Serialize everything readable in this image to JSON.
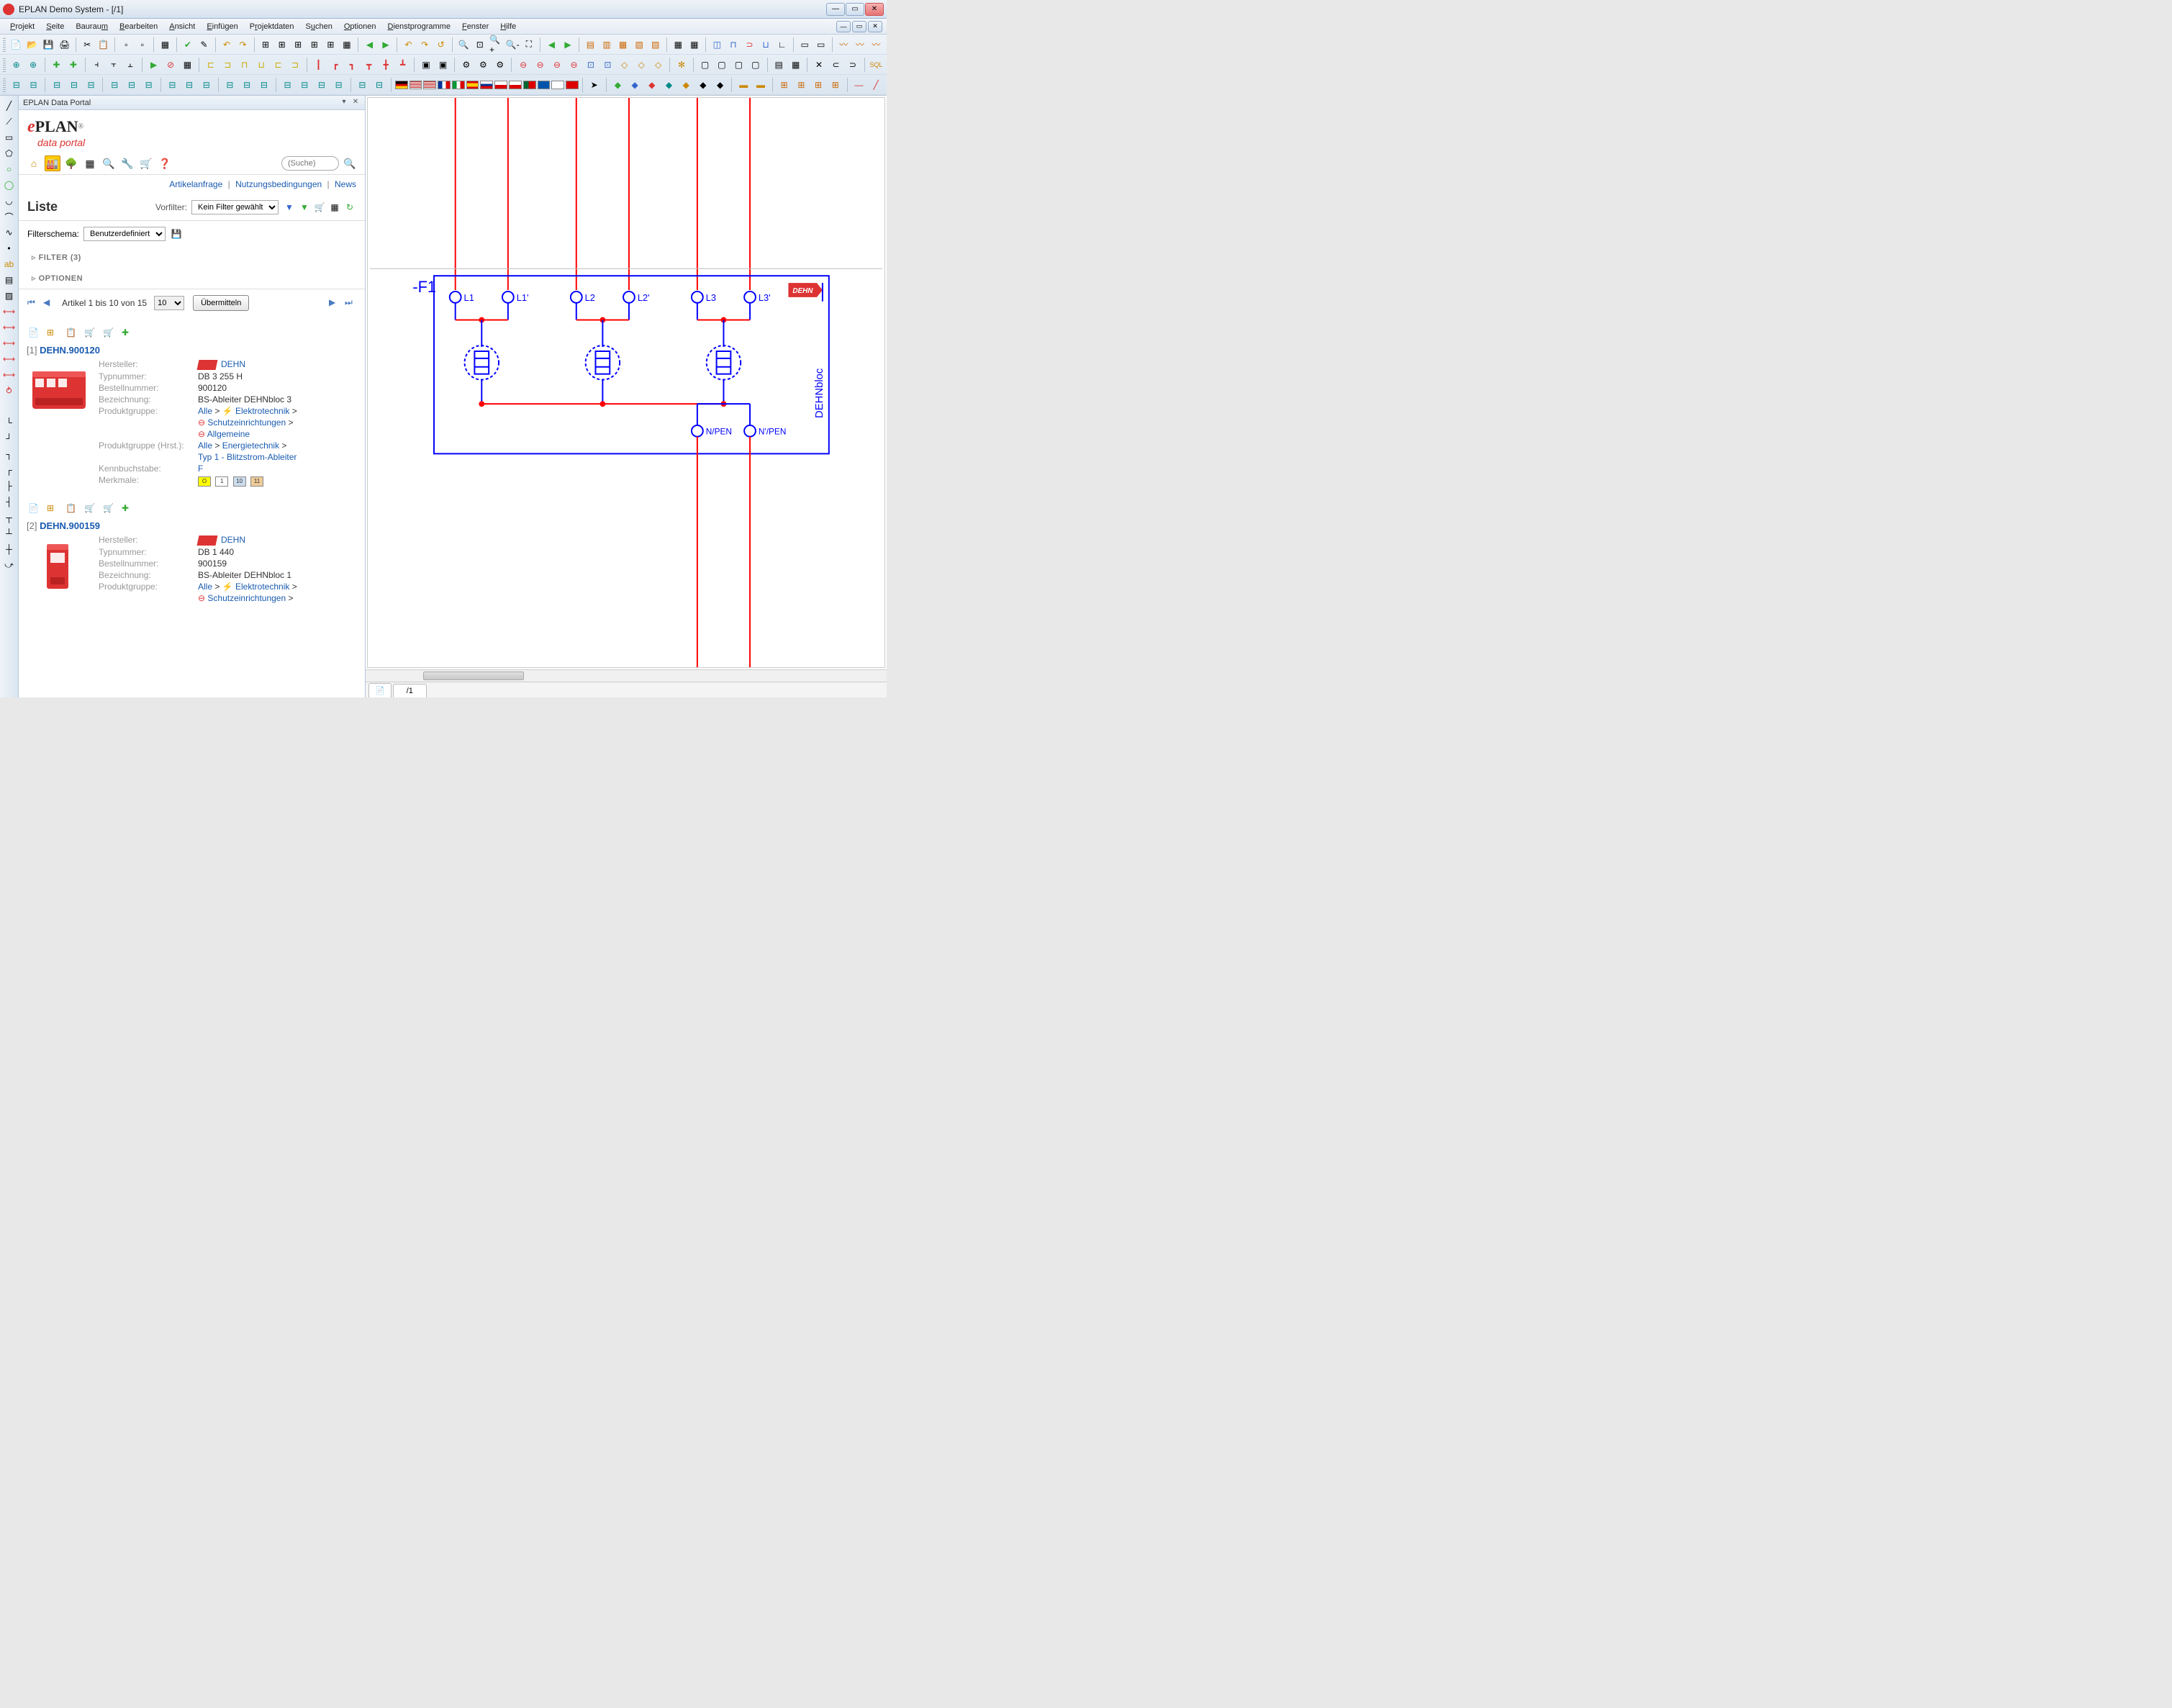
{
  "window": {
    "title": "EPLAN Demo System - [/1]"
  },
  "menu": {
    "items": [
      "Projekt",
      "Seite",
      "Bauraum",
      "Bearbeiten",
      "Ansicht",
      "Einfügen",
      "Projektdaten",
      "Suchen",
      "Optionen",
      "Dienstprogramme",
      "Fenster",
      "Hilfe"
    ]
  },
  "portal": {
    "panel_title": "EPLAN Data Portal",
    "logo_main": "PLAN",
    "logo_sub": "data portal",
    "search_placeholder": "(Suche)",
    "links": {
      "artikelanfrage": "Artikelanfrage",
      "nutzung": "Nutzungsbedingungen",
      "news": "News"
    },
    "liste_title": "Liste",
    "vorfilter_label": "Vorfilter:",
    "vorfilter_value": "Kein Filter gewählt",
    "filterschema_label": "Filterschema:",
    "filterschema_value": "Benutzerdefiniert",
    "filter_collapse": "FILTER (3)",
    "optionen_collapse": "OPTIONEN",
    "pager_text": "Artikel 1 bis 10 von 15",
    "pager_pagesize": "10",
    "pager_submit": "Übermitteln"
  },
  "items": [
    {
      "index": "[1]",
      "code": "DEHN.900120",
      "hersteller_label": "Hersteller:",
      "hersteller_value": "DEHN",
      "typnummer_label": "Typnummer:",
      "typnummer_value": "DB 3 255 H",
      "bestell_label": "Bestellnummer:",
      "bestell_value": "900120",
      "bezeichnung_label": "Bezeichnung:",
      "bezeichnung_value": "BS-Ableiter DEHNbloc 3",
      "produktgruppe_label": "Produktgruppe:",
      "pg_alle": "Alle",
      "pg_elektro": "Elektrotechnik",
      "pg_schutz": "Schutzeinrichtungen",
      "pg_allg": "Allgemeine",
      "produktgruppe_hrst_label": "Produktgruppe (Hrst.):",
      "pgh_alle": "Alle",
      "pgh_energie": "Energietechnik",
      "pgh_typ1": "Typ 1 - Blitzstrom-Ableiter",
      "kenn_label": "Kennbuchstabe:",
      "kenn_value": "F",
      "merkmale_label": "Merkmale:"
    },
    {
      "index": "[2]",
      "code": "DEHN.900159",
      "hersteller_label": "Hersteller:",
      "hersteller_value": "DEHN",
      "typnummer_label": "Typnummer:",
      "typnummer_value": "DB 1 440",
      "bestell_label": "Bestellnummer:",
      "bestell_value": "900159",
      "bezeichnung_label": "Bezeichnung:",
      "bezeichnung_value": "BS-Ableiter DEHNbloc 1",
      "produktgruppe_label": "Produktgruppe:",
      "pg_alle": "Alle",
      "pg_elektro": "Elektrotechnik",
      "pg_schutz": "Schutzeinrichtungen"
    }
  ],
  "schematic": {
    "device_tag": "-F1",
    "terminals": [
      "L1",
      "L1'",
      "L2",
      "L2'",
      "L3",
      "L3'",
      "N/PEN",
      "N'/PEN"
    ],
    "part_label": "DEHNbloc",
    "brand": "DEHN",
    "tab_label": "/1"
  }
}
